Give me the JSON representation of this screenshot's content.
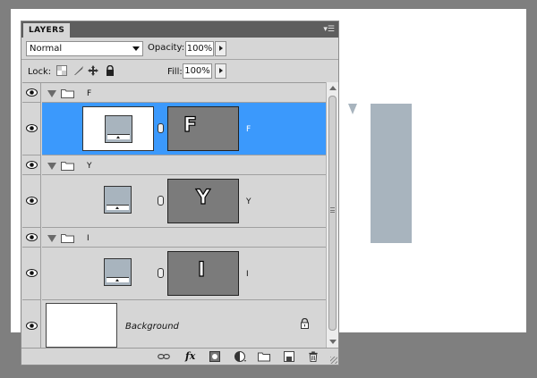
{
  "panel": {
    "tab_title": "LAYERS",
    "blend_mode": "Normal",
    "opacity_label": "Opacity:",
    "opacity_value": "100%",
    "lock_label": "Lock:",
    "fill_label": "Fill:",
    "fill_value": "100%"
  },
  "layers": [
    {
      "kind": "group",
      "name": "F",
      "visible": true,
      "expanded": true
    },
    {
      "kind": "layer",
      "name": "F",
      "mask_letter": "F",
      "visible": true,
      "selected": true
    },
    {
      "kind": "group",
      "name": "Y",
      "visible": true,
      "expanded": true
    },
    {
      "kind": "layer",
      "name": "Y",
      "mask_letter": "Y",
      "visible": true,
      "selected": false
    },
    {
      "kind": "group",
      "name": "I",
      "visible": true,
      "expanded": true
    },
    {
      "kind": "layer",
      "name": "I",
      "mask_letter": "I",
      "visible": true,
      "selected": false
    },
    {
      "kind": "background",
      "name": "Background",
      "visible": true,
      "locked": true
    }
  ],
  "toolbar": {
    "icons": [
      "link-layers-icon",
      "fx-icon",
      "add-mask-icon",
      "adjustment-layer-icon",
      "new-group-icon",
      "new-layer-icon",
      "trash-icon"
    ],
    "fx_label": "fx"
  },
  "colors": {
    "panel_bg": "#d6d6d6",
    "selection": "#3b99fc",
    "shape_fill": "#a8b4be",
    "mask_bg": "#7b7b7b",
    "workspace": "#7f7f7f"
  }
}
